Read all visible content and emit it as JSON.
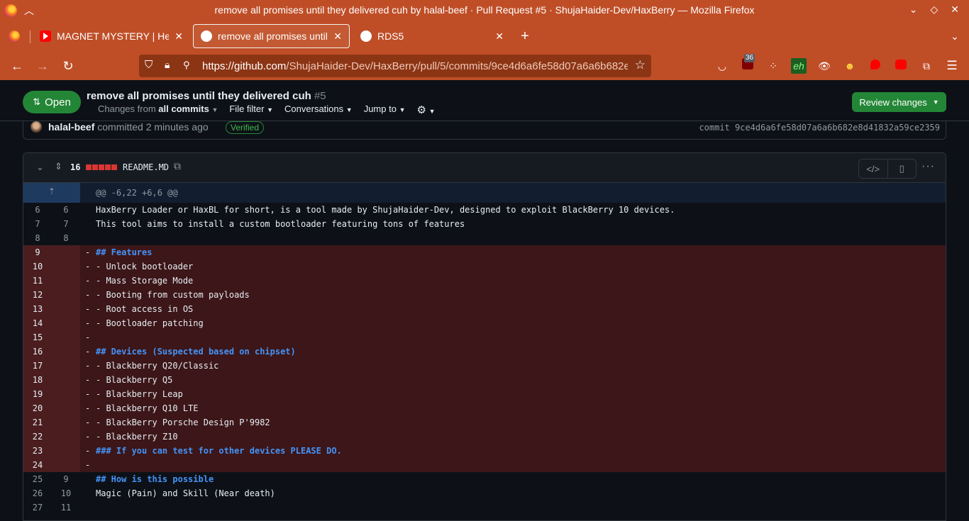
{
  "window": {
    "title": "remove all promises until they delivered cuh by halal-beef · Pull Request #5 · ShujaHaider-Dev/HaxBerry — Mozilla Firefox"
  },
  "tabs": [
    {
      "label": "MAGNET MYSTERY | Help r",
      "favicon": "youtube",
      "active": false
    },
    {
      "label": "remove all promises until t",
      "favicon": "github",
      "active": true
    },
    {
      "label": "RDS5",
      "favicon": "github",
      "active": false
    }
  ],
  "urlbar": {
    "host": "https://github.com",
    "path": "/ShujaHaider-Dev/HaxBerry/pull/5/commits/9ce4d6a6fe58d07a6a6b682e"
  },
  "extensions": {
    "badge_count": "36",
    "eh_label": "eh"
  },
  "pr": {
    "state_label": "Open",
    "title": "remove all promises until they delivered cuh",
    "number": "#5",
    "changes_from_prefix": "Changes from",
    "changes_from_value": "all commits",
    "file_filter": "File filter",
    "conversations": "Conversations",
    "jump_to": "Jump to",
    "review_button": "Review changes"
  },
  "commit": {
    "author": "halal-beef",
    "action": "committed 2 minutes ago",
    "verified": "Verified",
    "sha_label": "commit 9ce4d6a6fe58d07a6a6b682e8d41832a59ce2359"
  },
  "file": {
    "change_count": "16",
    "name": "README.MD",
    "hunk_header": "@@ -6,22 +6,6 @@"
  },
  "diff_lines": [
    {
      "type": "ctx",
      "old": "6",
      "new": "6",
      "sign": "",
      "text": "HaxBerry Loader or HaxBL for short, is a tool made by ShujaHaider-Dev, designed to exploit BlackBerry 10 devices.",
      "heading": false
    },
    {
      "type": "ctx",
      "old": "7",
      "new": "7",
      "sign": "",
      "text": "This tool aims to install a custom bootloader featuring tons of features",
      "heading": false
    },
    {
      "type": "ctx",
      "old": "8",
      "new": "8",
      "sign": "",
      "text": "",
      "heading": false
    },
    {
      "type": "del",
      "old": "9",
      "new": "",
      "sign": "-",
      "text": "## Features",
      "heading": true
    },
    {
      "type": "del",
      "old": "10",
      "new": "",
      "sign": "-",
      "text": "- Unlock bootloader",
      "heading": false
    },
    {
      "type": "del",
      "old": "11",
      "new": "",
      "sign": "-",
      "text": "- Mass Storage Mode",
      "heading": false
    },
    {
      "type": "del",
      "old": "12",
      "new": "",
      "sign": "-",
      "text": "- Booting from custom payloads",
      "heading": false
    },
    {
      "type": "del",
      "old": "13",
      "new": "",
      "sign": "-",
      "text": "- Root access in OS",
      "heading": false
    },
    {
      "type": "del",
      "old": "14",
      "new": "",
      "sign": "-",
      "text": "- Bootloader patching",
      "heading": false
    },
    {
      "type": "del",
      "old": "15",
      "new": "",
      "sign": "-",
      "text": "",
      "heading": false
    },
    {
      "type": "del",
      "old": "16",
      "new": "",
      "sign": "-",
      "text": "## Devices (Suspected based on chipset)",
      "heading": true
    },
    {
      "type": "del",
      "old": "17",
      "new": "",
      "sign": "-",
      "text": "- Blackberry Q20/Classic",
      "heading": false
    },
    {
      "type": "del",
      "old": "18",
      "new": "",
      "sign": "-",
      "text": "- Blackberry Q5",
      "heading": false
    },
    {
      "type": "del",
      "old": "19",
      "new": "",
      "sign": "-",
      "text": "- Blackberry Leap",
      "heading": false
    },
    {
      "type": "del",
      "old": "20",
      "new": "",
      "sign": "-",
      "text": "- Blackberry Q10 LTE",
      "heading": false
    },
    {
      "type": "del",
      "old": "21",
      "new": "",
      "sign": "-",
      "text": "- BlackBerry Porsche Design P'9982",
      "heading": false
    },
    {
      "type": "del",
      "old": "22",
      "new": "",
      "sign": "-",
      "text": "- Blackberry Z10",
      "heading": false
    },
    {
      "type": "del",
      "old": "23",
      "new": "",
      "sign": "-",
      "text": "### If you can test for other devices PLEASE DO.",
      "heading": true
    },
    {
      "type": "del",
      "old": "24",
      "new": "",
      "sign": "-",
      "text": "",
      "heading": false
    },
    {
      "type": "ctx",
      "old": "25",
      "new": "9",
      "sign": "",
      "text": "## How is this possible",
      "heading": true
    },
    {
      "type": "ctx",
      "old": "26",
      "new": "10",
      "sign": "",
      "text": "Magic (Pain) and Skill (Near death)",
      "heading": false
    },
    {
      "type": "ctx",
      "old": "27",
      "new": "11",
      "sign": "",
      "text": "",
      "heading": false
    }
  ],
  "colors": {
    "titlebar": "#bf4e27",
    "open_green": "#238636",
    "deletion_bg": "#3c1618",
    "heading_blue": "#4493f8"
  }
}
